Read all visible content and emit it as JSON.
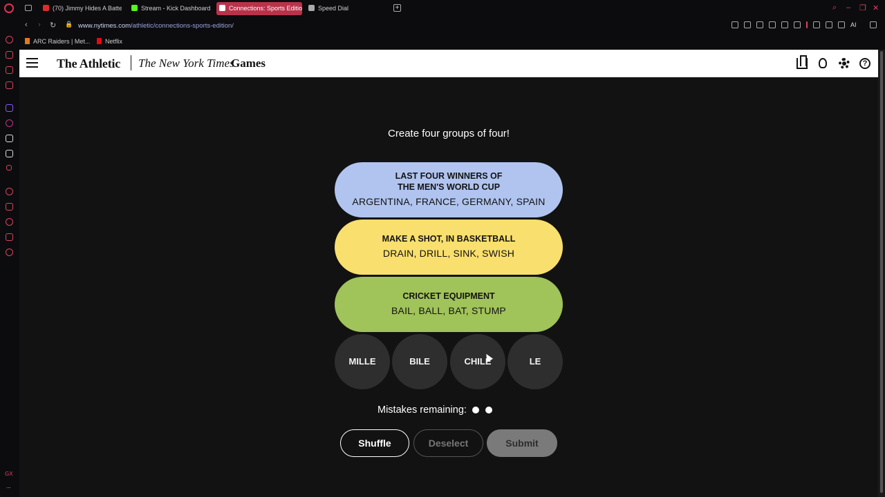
{
  "browser": {
    "tabs": [
      {
        "label": "(70) Jimmy Hides A Batte",
        "favicon_color": "#e02b2b"
      },
      {
        "label": "Stream - Kick Dashboard",
        "favicon_color": "#53fc18"
      },
      {
        "label": "Connections: Sports Editio",
        "favicon_color": "#ffffff"
      },
      {
        "label": "Speed Dial",
        "favicon_color": "#aaaaaa"
      }
    ],
    "url_host": "www.nytimes.com",
    "url_path": "/athletic/connections-sports-edition/",
    "ai_label": "AI",
    "bookmarks": [
      {
        "label": "ARC Raiders | Met...",
        "favicon_color": "#e07a1f"
      },
      {
        "label": "Netflix",
        "favicon_color": "#e50914"
      }
    ],
    "sidebar_gx_label": "GX",
    "sidebar_more_label": "..."
  },
  "header": {
    "brand_athletic": "The Athletic",
    "brand_nyt": "The New York Times",
    "brand_games": "Games"
  },
  "game": {
    "instructions": "Create four groups of four!",
    "solved_groups": [
      {
        "category_line1": "LAST FOUR WINNERS OF",
        "category_line2": "THE MEN'S WORLD CUP",
        "words": "ARGENTINA, FRANCE, GERMANY, SPAIN",
        "color": "#b0c4ef"
      },
      {
        "category_line1": "MAKE A SHOT, IN BASKETBALL",
        "words": "DRAIN, DRILL, SINK, SWISH",
        "color": "#f9df6d"
      },
      {
        "category_line1": "CRICKET EQUIPMENT",
        "words": "BAIL, BALL, BAT, STUMP",
        "color": "#a0c35a"
      }
    ],
    "remaining_cards": [
      "MILLE",
      "BILE",
      "CHILE",
      "LE"
    ],
    "mistakes_label": "Mistakes remaining:",
    "mistakes_remaining": 2,
    "buttons": {
      "shuffle": "Shuffle",
      "deselect": "Deselect",
      "submit": "Submit"
    }
  }
}
